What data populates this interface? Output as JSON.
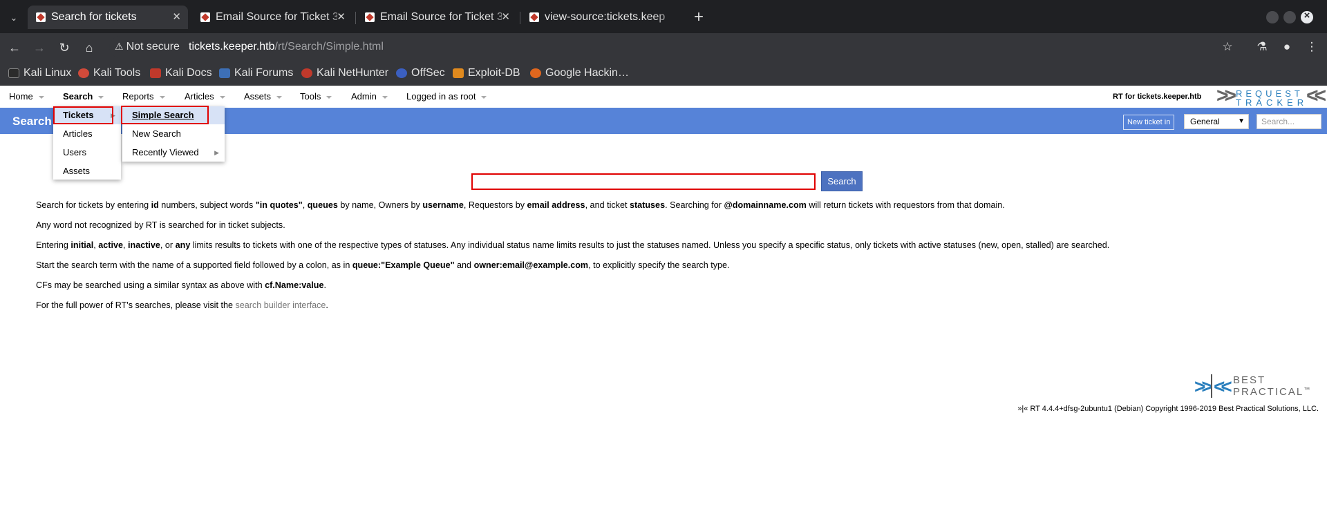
{
  "browser": {
    "tabs": [
      {
        "title": "Search for tickets",
        "active": true
      },
      {
        "title": "Email Source for Ticket 3",
        "active": false
      },
      {
        "title": "Email Source for Ticket 3",
        "active": false
      },
      {
        "title": "view-source:tickets.keep",
        "active": false
      }
    ],
    "security_label": "Not secure",
    "url_host": "tickets.keeper.htb",
    "url_path": "/rt/Search/Simple.html",
    "bookmarks": [
      "Kali Linux",
      "Kali Tools",
      "Kali Docs",
      "Kali Forums",
      "Kali NetHunter",
      "OffSec",
      "Exploit-DB",
      "Google Hackin…"
    ]
  },
  "rt": {
    "menu": [
      "Home",
      "Search",
      "Reports",
      "Articles",
      "Assets",
      "Tools",
      "Admin",
      "Logged in as root"
    ],
    "instance_label": "RT for tickets.keeper.htb",
    "logo_line1": "REQUEST",
    "logo_line2": "TRACKER",
    "page_title": "Search",
    "new_ticket_label": "New ticket in",
    "queue_selected": "General",
    "quick_search_placeholder": "Search...",
    "search_button": "Search",
    "search_menu": [
      "Tickets",
      "Articles",
      "Users",
      "Assets"
    ],
    "tickets_submenu": [
      "Simple Search",
      "New Search",
      "Recently Viewed"
    ],
    "help": {
      "p1": {
        "t1": "Search for tickets by entering ",
        "b1": "id",
        "t2": " numbers, subject words ",
        "b2": "\"in quotes\"",
        "t3": ", ",
        "b3": "queues",
        "t4": " by name, Owners by ",
        "b4": "username",
        "t5": ", Requestors by ",
        "b5": "email address",
        "t6": ", and ticket ",
        "b6": "statuses",
        "t7": ". Searching for ",
        "b7": "@domainname.com",
        "t8": " will return tickets with requestors from that domain."
      },
      "p2": "Any word not recognized by RT is searched for in ticket subjects.",
      "p3": {
        "t1": "Entering ",
        "b1": "initial",
        "t2": ", ",
        "b2": "active",
        "t3": ", ",
        "b3": "inactive",
        "t4": ", or ",
        "b4": "any",
        "t5": " limits results to tickets with one of the respective types of statuses. Any individual status name limits results to just the statuses named. Unless you specify a specific status, only tickets with active statuses (new, open, stalled) are searched."
      },
      "p4": {
        "t1": "Start the search term with the name of a supported field followed by a colon, as in ",
        "b1": "queue:\"Example Queue\"",
        "t2": " and ",
        "b2": "owner:email@example.com",
        "t3": ", to explicitly specify the search type."
      },
      "p5": {
        "t1": "CFs may be searched using a similar syntax as above with ",
        "b1": "cf.Name:value",
        "t2": "."
      },
      "p6": {
        "t1": "For the full power of RT's searches, please visit the ",
        "link": "search builder interface",
        "t2": "."
      }
    },
    "bp_logo_line1": "BEST",
    "bp_logo_line2": "PRACTICAL",
    "bp_logo_tm": "™",
    "footer": "»|« RT 4.4.4+dfsg-2ubuntu1 (Debian) Copyright 1996-2019 Best Practical Solutions, LLC."
  },
  "colors": {
    "rt_header": "#5683d8",
    "highlight_box": "#e00000",
    "menu_highlight": "#d7e2f6"
  }
}
